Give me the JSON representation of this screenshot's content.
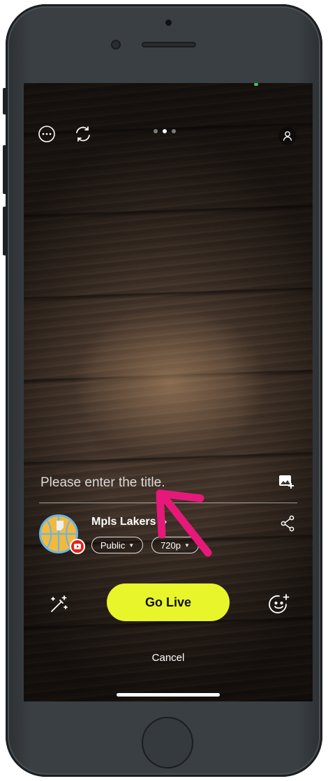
{
  "top_bar": {
    "more_icon": "more-horizontal-icon",
    "flip_icon": "camera-flip-icon",
    "profile_icon": "person-icon",
    "page_dots": 3,
    "active_dot": 1
  },
  "title_input": {
    "placeholder": "Please enter the title.",
    "value": ""
  },
  "channel": {
    "name": "Mpls Lakers",
    "chevron": "›",
    "platform_badge": "youtube-badge-icon"
  },
  "privacy": {
    "selected": "Public"
  },
  "quality": {
    "selected": "720p"
  },
  "actions": {
    "go_live_label": "Go Live",
    "cancel_label": "Cancel"
  },
  "colors": {
    "go_live_bg": "#e8f52b",
    "annotation_arrow": "#e6197a",
    "badge_red": "#e62117"
  }
}
